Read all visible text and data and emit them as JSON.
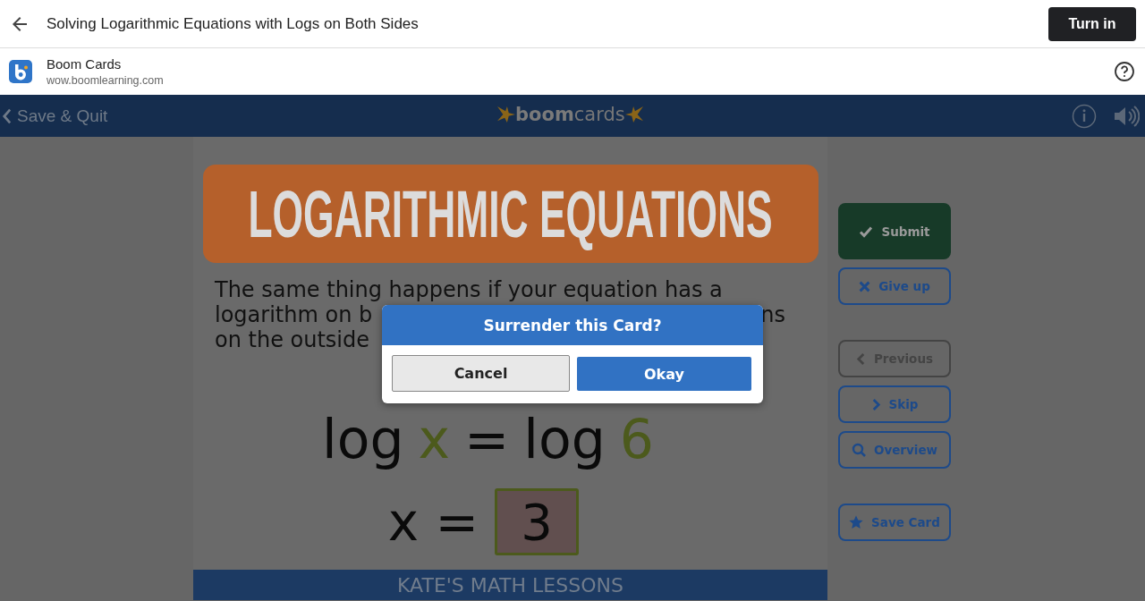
{
  "top_bar": {
    "title": "Solving Logarithmic Equations with Logs on Both Sides",
    "turn_in": "Turn in"
  },
  "app_row": {
    "name": "Boom Cards",
    "url": "wow.boomlearning.com"
  },
  "boom_bar": {
    "back": "Save & Quit",
    "logo_left": "boom",
    "logo_right": "cards"
  },
  "card": {
    "banner": "LOGARITHMIC EQUATIONS",
    "paragraph_lines": [
      [
        "The same thing happens if your equation has a"
      ],
      [
        "logarithm on b",
        "ns"
      ],
      [
        "on the outside"
      ]
    ],
    "equation": [
      {
        "text": "log",
        "highlighted": false
      },
      {
        "text": "x",
        "highlighted": true
      },
      {
        "text": "=",
        "highlighted": false
      },
      {
        "text": "log",
        "highlighted": false
      },
      {
        "text": "6",
        "highlighted": true
      }
    ],
    "answer_label": "x =",
    "answer": {
      "value": "3"
    },
    "footer": "KATE'S MATH LESSONS"
  },
  "side_buttons": [
    {
      "label": "Submit",
      "kind": "submit",
      "disabled": false
    },
    {
      "label": "Give up",
      "kind": "giveup",
      "disabled": false
    },
    {
      "label": "Previous",
      "kind": "previous",
      "disabled": true
    },
    {
      "label": "Skip",
      "kind": "skip",
      "disabled": false
    },
    {
      "label": "Overview",
      "kind": "overview",
      "disabled": false
    },
    {
      "label": "Save Card",
      "kind": "save",
      "disabled": false
    }
  ],
  "dialog": {
    "title": "Surrender this Card?",
    "buttons": [
      {
        "label": "Cancel",
        "kind": "secondary"
      },
      {
        "label": "Okay",
        "kind": "primary"
      }
    ]
  }
}
